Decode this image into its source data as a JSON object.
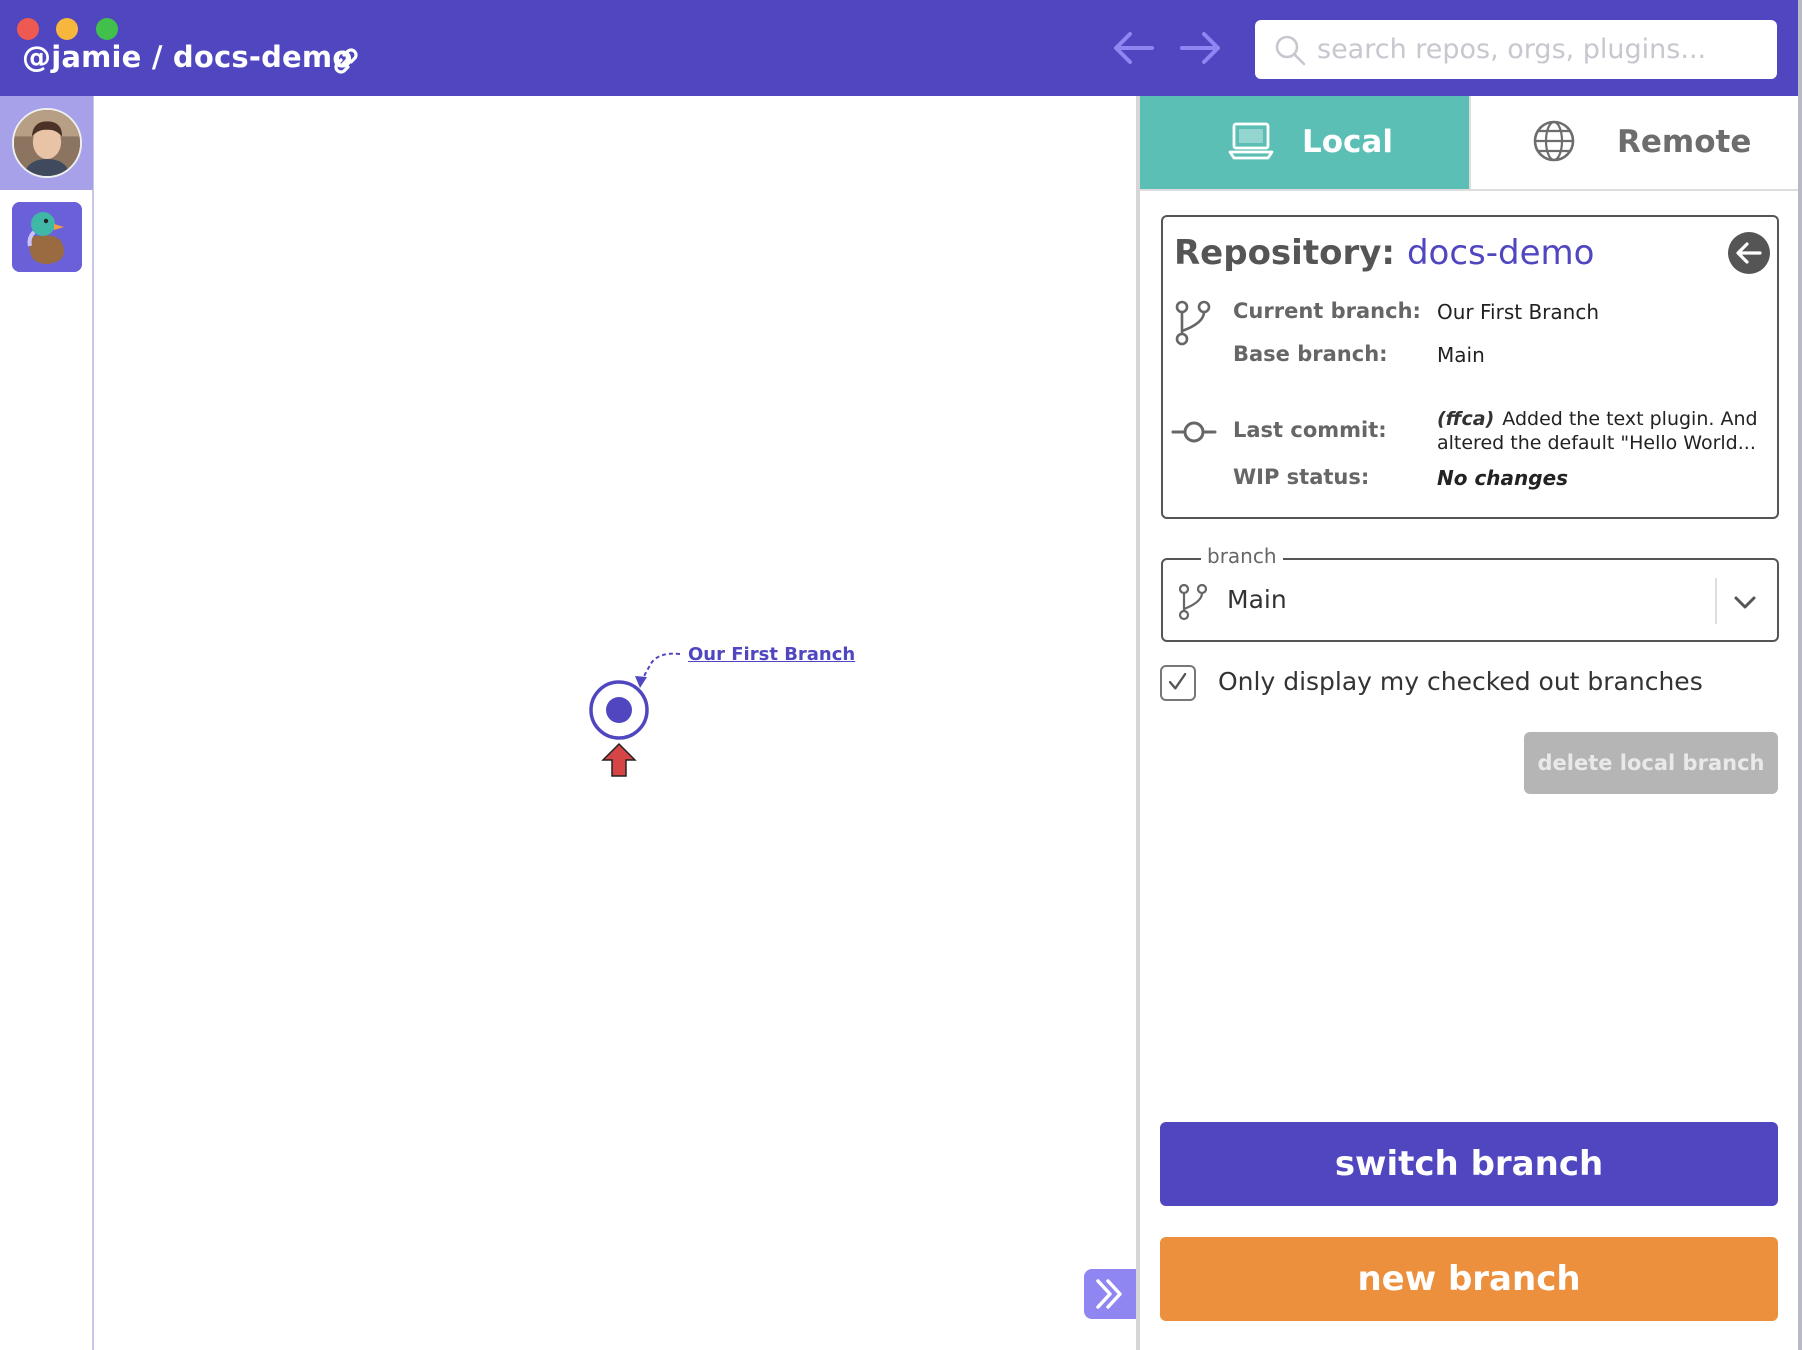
{
  "app": {
    "title": "@jamie / docs-demo"
  },
  "search": {
    "placeholder": "search repos, orgs, plugins..."
  },
  "graph": {
    "branch_label": "Our First Branch"
  },
  "tabs": [
    {
      "label": "Local",
      "icon": "laptop-icon",
      "active": true
    },
    {
      "label": "Remote",
      "icon": "globe-icon",
      "active": false
    }
  ],
  "repo": {
    "label": "Repository:",
    "name": "docs-demo",
    "current_branch_label": "Current branch:",
    "current_branch": "Our First Branch",
    "base_branch_label": "Base branch:",
    "base_branch": "Main",
    "last_commit_label": "Last commit:",
    "last_commit_hash": "(ffca)",
    "last_commit_message": "Added the text plugin. And altered the default \"Hello World...",
    "wip_label": "WIP status:",
    "wip_status": "No changes"
  },
  "branch_select": {
    "legend": "branch",
    "value": "Main"
  },
  "filter": {
    "label": "Only display my checked out branches",
    "checked": true
  },
  "buttons": {
    "delete": "delete local branch",
    "switch": "switch branch",
    "new": "new branch"
  },
  "colors": {
    "brand": "#5046c0",
    "local_tab": "#5bbfb6",
    "new_branch": "#ec903e",
    "disabled": "#b5b5b5",
    "head_marker": "#d64545"
  }
}
